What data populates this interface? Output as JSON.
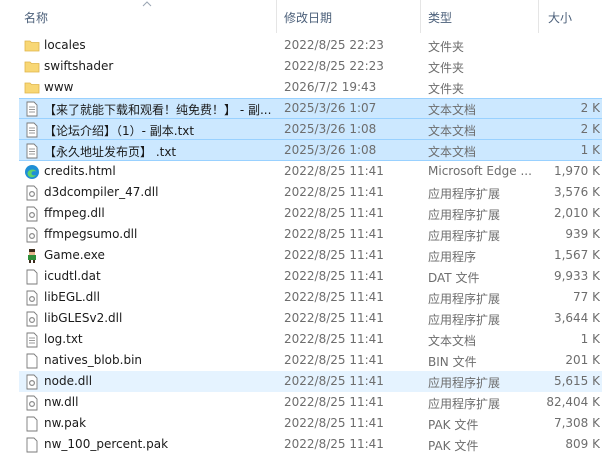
{
  "columns": {
    "name": "名称",
    "date": "修改日期",
    "type": "类型",
    "size": "大小"
  },
  "files": [
    {
      "name": "locales",
      "date": "2022/8/25 22:23",
      "type": "文件夹",
      "size": "",
      "icon": "folder-icon"
    },
    {
      "name": "swiftshader",
      "date": "2022/8/25 22:23",
      "type": "文件夹",
      "size": "",
      "icon": "folder-icon"
    },
    {
      "name": "www",
      "date": "2026/7/2 19:43",
      "type": "文件夹",
      "size": "",
      "icon": "folder-icon"
    },
    {
      "name": "【来了就能下载和观看！纯免费！】 - 副...",
      "date": "2025/3/26 1:07",
      "type": "文本文档",
      "size": "2 K",
      "icon": "text-file-icon"
    },
    {
      "name": "【论坛介绍】（1）- 副本.txt",
      "date": "2025/3/26 1:08",
      "type": "文本文档",
      "size": "2 K",
      "icon": "text-file-icon"
    },
    {
      "name": "【永久地址发布页】 .txt",
      "date": "2025/3/26 1:08",
      "type": "文本文档",
      "size": "1 K",
      "icon": "text-file-icon"
    },
    {
      "name": "credits.html",
      "date": "2022/8/25 11:41",
      "type": "Microsoft Edge ...",
      "size": "1,970 K",
      "icon": "edge-icon"
    },
    {
      "name": "d3dcompiler_47.dll",
      "date": "2022/8/25 11:41",
      "type": "应用程序扩展",
      "size": "3,576 K",
      "icon": "dll-icon"
    },
    {
      "name": "ffmpeg.dll",
      "date": "2022/8/25 11:41",
      "type": "应用程序扩展",
      "size": "2,010 K",
      "icon": "dll-icon"
    },
    {
      "name": "ffmpegsumo.dll",
      "date": "2022/8/25 11:41",
      "type": "应用程序扩展",
      "size": "939 K",
      "icon": "dll-icon"
    },
    {
      "name": "Game.exe",
      "date": "2022/8/25 11:41",
      "type": "应用程序",
      "size": "1,567 K",
      "icon": "game-exe-icon"
    },
    {
      "name": "icudtl.dat",
      "date": "2022/8/25 11:41",
      "type": "DAT 文件",
      "size": "9,933 K",
      "icon": "blank-file-icon"
    },
    {
      "name": "libEGL.dll",
      "date": "2022/8/25 11:41",
      "type": "应用程序扩展",
      "size": "77 K",
      "icon": "dll-icon"
    },
    {
      "name": "libGLESv2.dll",
      "date": "2022/8/25 11:41",
      "type": "应用程序扩展",
      "size": "3,644 K",
      "icon": "dll-icon"
    },
    {
      "name": "log.txt",
      "date": "2022/8/25 11:41",
      "type": "文本文档",
      "size": "1 K",
      "icon": "text-file-icon"
    },
    {
      "name": "natives_blob.bin",
      "date": "2022/8/25 11:41",
      "type": "BIN 文件",
      "size": "201 K",
      "icon": "blank-file-icon"
    },
    {
      "name": "node.dll",
      "date": "2022/8/25 11:41",
      "type": "应用程序扩展",
      "size": "5,615 K",
      "icon": "dll-icon"
    },
    {
      "name": "nw.dll",
      "date": "2022/8/25 11:41",
      "type": "应用程序扩展",
      "size": "82,404 K",
      "icon": "dll-icon"
    },
    {
      "name": "nw.pak",
      "date": "2022/8/25 11:41",
      "type": "PAK 文件",
      "size": "7,308 K",
      "icon": "blank-file-icon"
    },
    {
      "name": "nw_100_percent.pak",
      "date": "2022/8/25 11:41",
      "type": "PAK 文件",
      "size": "809 K",
      "icon": "blank-file-icon"
    }
  ]
}
